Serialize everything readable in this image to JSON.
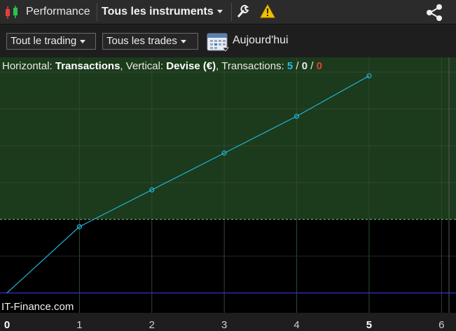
{
  "topbar": {
    "title": "Performance",
    "instrument_selector": "Tous les instruments",
    "icons": [
      "candlestick-icon",
      "wrench-icon",
      "warning-icon",
      "share-icon"
    ]
  },
  "toolbar": {
    "trading_filter": "Tout le trading",
    "trades_filter": "Tous les trades",
    "date_label": "Aujourd'hui",
    "icons": [
      "calendar-icon"
    ]
  },
  "info": {
    "horizontal_label": "Horizontal:",
    "horizontal_value": "Transactions",
    "vertical_label": "Vertical:",
    "vertical_value": "Devise (€)",
    "transactions_label": "Transactions:",
    "count_total": "5",
    "count_mid": "0",
    "count_neg": "0",
    "sep": "/"
  },
  "watermark": "IT-Finance.com",
  "colors": {
    "positive_zone": "#1c3a1c",
    "negative_zone": "#000000",
    "line": "#1fb4d6",
    "baseline": "#3030c8",
    "count_total": "#2ab8e8",
    "count_neg": "#e0442e"
  },
  "chart_data": {
    "type": "line",
    "x": [
      0,
      1,
      2,
      3,
      4,
      5
    ],
    "series": [
      {
        "values": [
          0,
          0.9,
          1.4,
          1.9,
          2.4,
          2.95
        ]
      }
    ],
    "x_ticks": [
      "0",
      "1",
      "2",
      "3",
      "4",
      "5",
      "6"
    ],
    "x_bold_ticks": [
      "0",
      "5"
    ],
    "xlim": [
      0,
      6.2
    ],
    "ylim": [
      -0.27,
      3.2
    ],
    "threshold": 1.0,
    "grid": true
  }
}
